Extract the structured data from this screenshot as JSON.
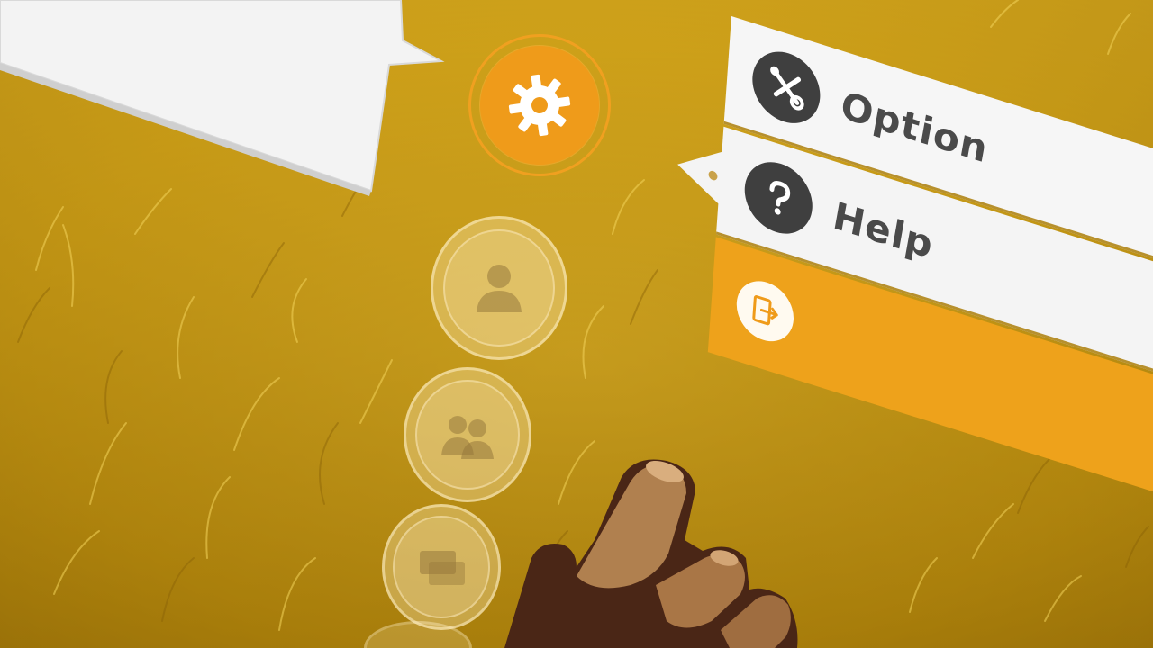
{
  "menu": {
    "items": [
      {
        "label": "Option",
        "icon": "wrench-screwdriver-icon"
      },
      {
        "label": "Help",
        "icon": "question-icon"
      },
      {
        "label": "",
        "icon": "logout-icon"
      }
    ]
  },
  "ring_menu": {
    "buttons": [
      {
        "icon": "gear-icon",
        "state": "active"
      },
      {
        "icon": "person-icon",
        "state": "faded"
      },
      {
        "icon": "people-icon",
        "state": "faded"
      },
      {
        "icon": "message-icon",
        "state": "faded"
      }
    ]
  },
  "colors": {
    "accent": "#ef9b1a",
    "panel": "#f6f6f6",
    "icon_dark": "#3f3f3f",
    "divider": "#b7902d",
    "background": "#c99a14"
  }
}
